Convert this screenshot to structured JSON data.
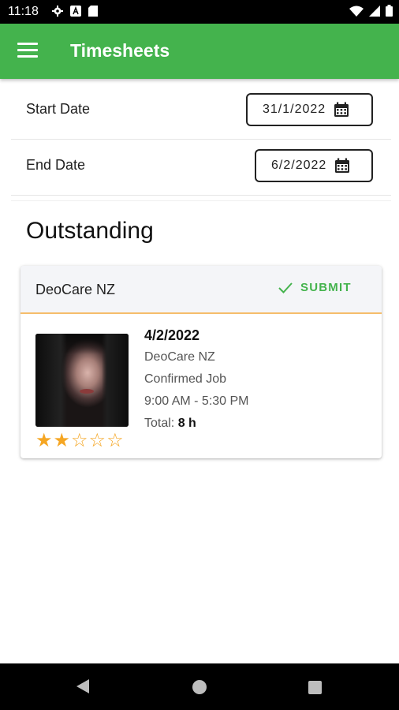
{
  "status_bar": {
    "time": "11:18",
    "icons_left": [
      "gear-icon",
      "a-badge-icon",
      "sd-card-icon"
    ],
    "icons_right": [
      "wifi-icon",
      "signal-icon",
      "battery-icon"
    ]
  },
  "app_bar": {
    "title": "Timesheets",
    "menu_icon": "hamburger-menu-icon",
    "color": "#44b34d"
  },
  "filters": {
    "start_label": "Start Date",
    "start_value": "31/1/2022",
    "end_label": "End Date",
    "end_value": "6/2/2022",
    "calendar_icon": "calendar-icon"
  },
  "section": {
    "title": "Outstanding"
  },
  "card": {
    "company": "DeoCare NZ",
    "submit_label": "SUBMIT",
    "submit_icon": "check-icon",
    "accent_color": "#f5bd6b",
    "date": "4/2/2022",
    "client": "DeoCare NZ",
    "status": "Confirmed Job",
    "time_range": "9:00 AM - 5:30 PM",
    "total_label": "Total:",
    "total_value": "8 h",
    "rating": 2,
    "rating_max": 5
  }
}
